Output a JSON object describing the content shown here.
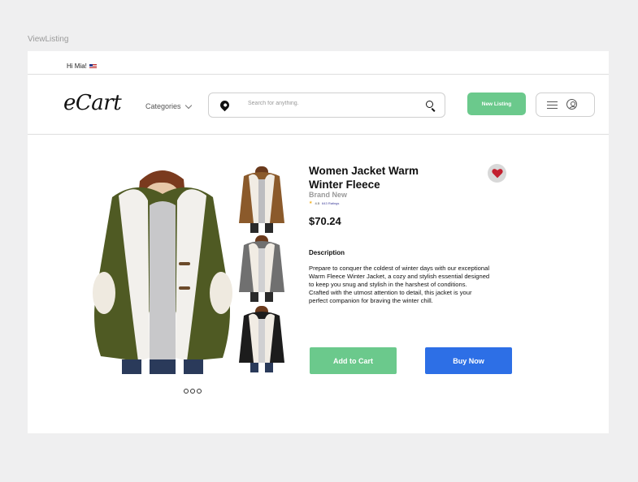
{
  "frame_label": "ViewListing",
  "topbar": {
    "greeting": "Hi Mia!",
    "flag_icon": "us-flag-icon"
  },
  "header": {
    "logo": "eCart",
    "categories_label": "Categories",
    "search": {
      "placeholder": "Search for anything.",
      "value": ""
    },
    "new_listing_label": "New Listing",
    "icons": [
      "location-pin-icon",
      "search-icon",
      "hamburger-menu-icon",
      "user-profile-icon",
      "chevron-down-icon"
    ]
  },
  "product": {
    "title": "Women Jacket Warm Winter Fleece",
    "brand": "Brand New",
    "rating": "4.5",
    "rating_count": "643 Ratings",
    "price": "$70.24",
    "favorited": true,
    "description_title": "Description",
    "description": "Prepare to conquer the coldest of winter days with our exceptional\nWarm Fleece Winter Jacket, a cozy and stylish essential designed\n to keep you snug and stylish in the harshest of conditions.\nCrafted with the utmost attention to detail, this jacket is your\nperfect companion for braving the winter chill.",
    "images": [
      {
        "name": "olive-green-jacket",
        "color": "#4f5a23"
      },
      {
        "name": "brown-jacket",
        "color": "#8b5a2b"
      },
      {
        "name": "grey-jacket",
        "color": "#707070"
      },
      {
        "name": "black-jacket",
        "color": "#1c1c1c"
      }
    ],
    "carousel_dots": 3
  },
  "actions": {
    "add_to_cart": "Add to Cart",
    "buy_now": "Buy Now"
  },
  "colors": {
    "primary_green": "#6bc98c",
    "primary_blue": "#2d6fe6",
    "heart_red": "#c2202f"
  }
}
